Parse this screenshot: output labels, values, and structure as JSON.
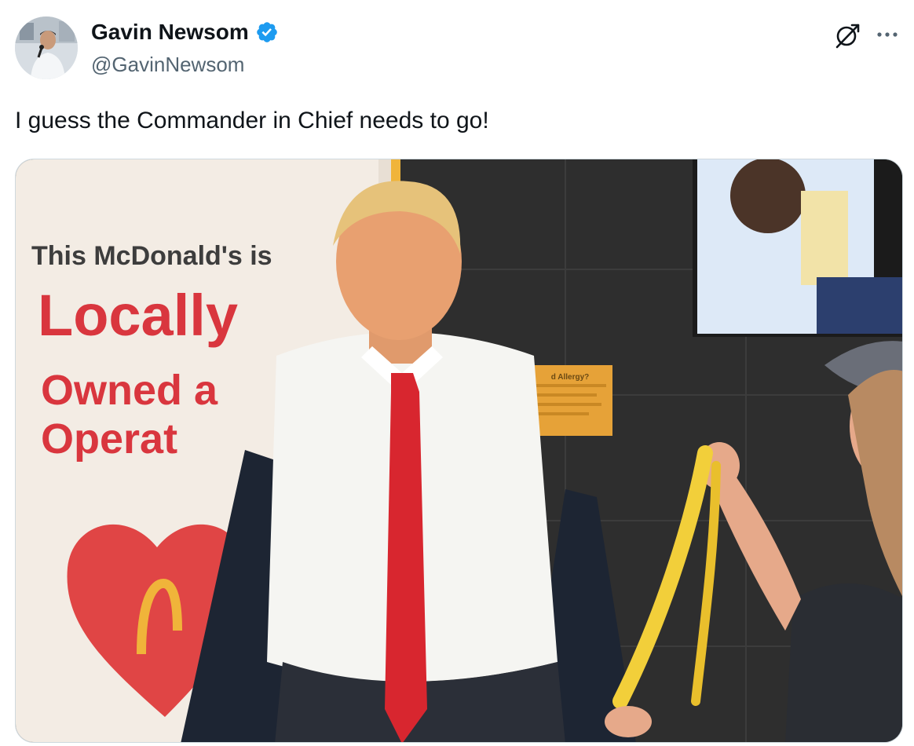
{
  "tweet": {
    "author": {
      "display_name": "Gavin Newsom",
      "handle": "@GavinNewsom",
      "verified": true
    },
    "text": "I guess the Commander in Chief needs to go!",
    "media": {
      "sign": {
        "line1": "This McDonald's is",
        "line2": "Locally",
        "line3": "Owned a",
        "line4": "Operat"
      },
      "placard_text": "d Allergy?"
    }
  },
  "colors": {
    "verified_badge": "#1d9bf0",
    "primary_text": "#0f1419",
    "secondary_text": "#536471",
    "sign_red": "#d9363e"
  },
  "icons": [
    "verified-badge-icon",
    "grok-icon",
    "more-icon"
  ]
}
